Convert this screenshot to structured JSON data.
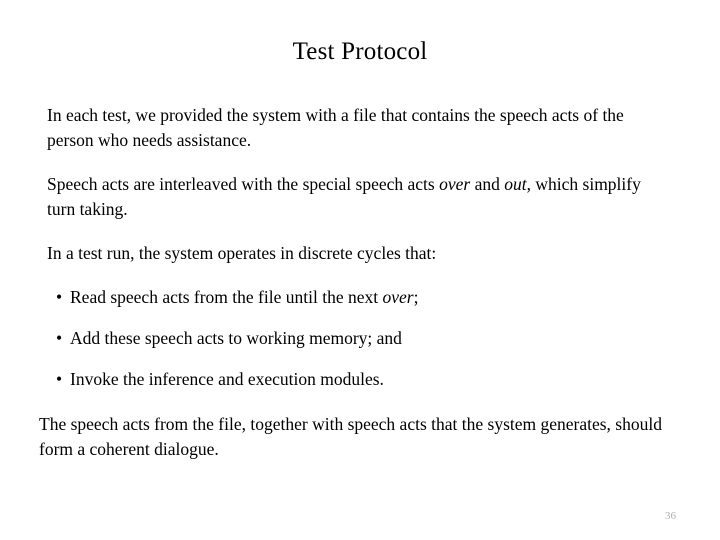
{
  "slide": {
    "title": "Test Protocol",
    "page_number": "36",
    "background_color": "#ffffff",
    "text_color": "#000000",
    "page_number_color": "#b0b0b0"
  },
  "paragraphs": {
    "p1": "In each test, we provided the system with a file that contains the speech acts of the person who needs assistance.",
    "p2_part1": "Speech acts are interleaved with the special speech acts ",
    "p2_italic1": "over",
    "p2_part2": " and ",
    "p2_italic2": "out",
    "p2_part3": ", which simplify turn taking.",
    "p3": "In a test run, the system operates in discrete cycles that:",
    "p4": "The speech acts from the file, together with speech acts that the system generates, should form a coherent dialogue."
  },
  "bullets": [
    {
      "marker": "•",
      "text_part1": "Read speech acts from the file until the next ",
      "italic": "over",
      "text_part2": ";"
    },
    {
      "marker": "•",
      "text_part1": "Add these speech acts to working memory; and",
      "italic": "",
      "text_part2": ""
    },
    {
      "marker": "•",
      "text_part1": "Invoke the inference and execution modules.",
      "italic": "",
      "text_part2": ""
    }
  ]
}
